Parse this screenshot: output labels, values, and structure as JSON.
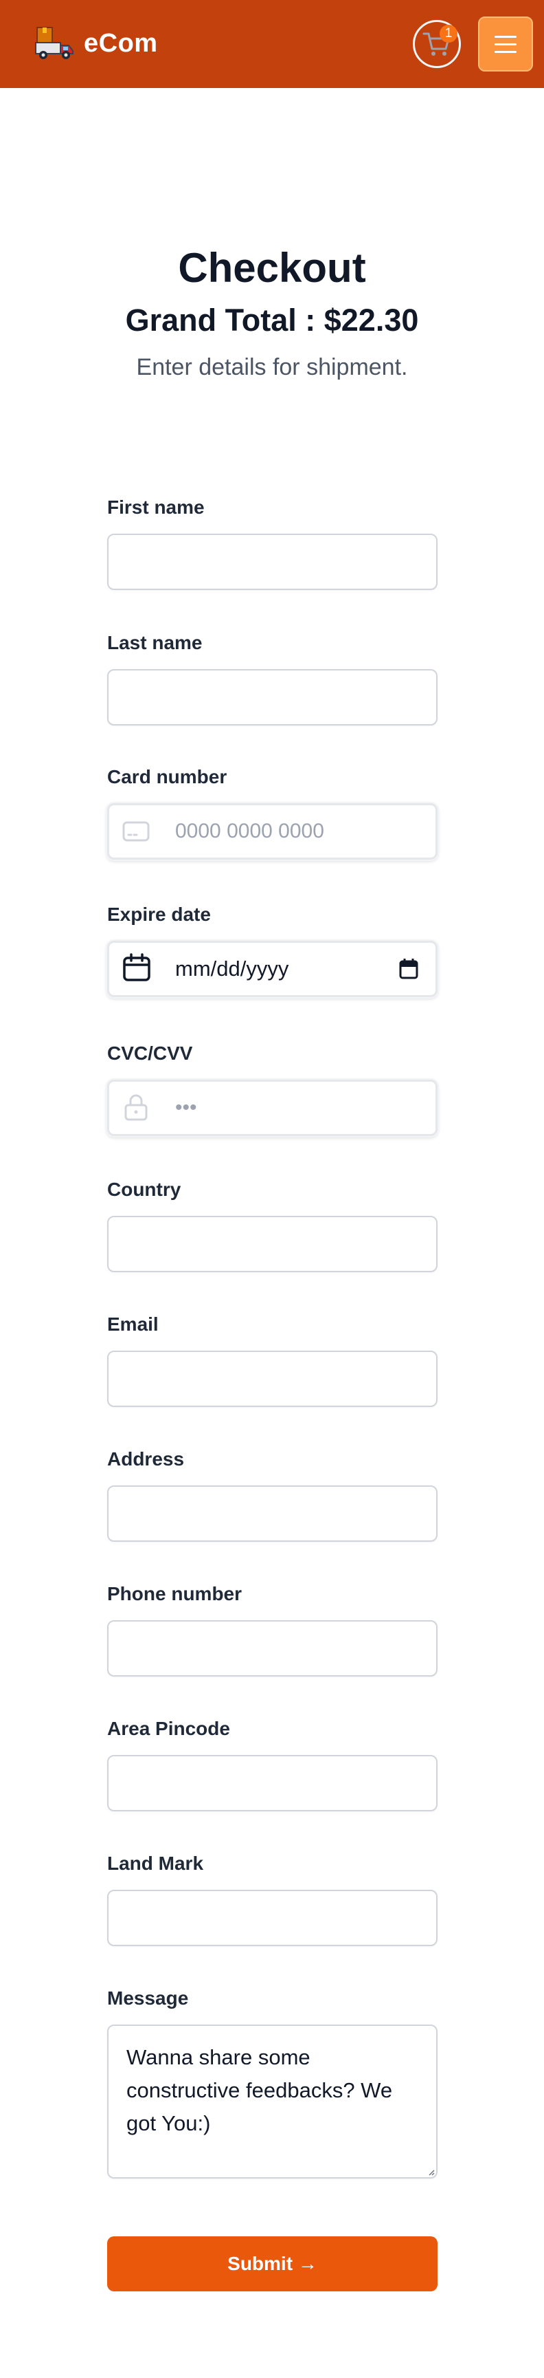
{
  "navbar": {
    "brand_name": "eCom",
    "cart_count": "1",
    "colors": {
      "bar": "#c2410c",
      "menu_button": "#fb923c",
      "badge": "#f97316"
    },
    "icons": {
      "logo": "delivery-truck-icon",
      "cart": "shopping-cart-icon",
      "menu": "hamburger-menu-icon"
    }
  },
  "checkout": {
    "title": "Checkout",
    "grand_total": "Grand Total : $22.30",
    "subtitle": "Enter details for shipment."
  },
  "form": {
    "first_name": {
      "label": "First name",
      "value": ""
    },
    "last_name": {
      "label": "Last name",
      "value": ""
    },
    "card_number": {
      "label": "Card number",
      "placeholder": "0000 0000 0000",
      "icon": "credit-card-icon"
    },
    "expire_date": {
      "label": "Expire date",
      "placeholder": "mm/dd/yyyy",
      "icon": "calendar-icon"
    },
    "cvc": {
      "label": "CVC/CVV",
      "placeholder": "•••",
      "icon": "lock-icon"
    },
    "country": {
      "label": "Country",
      "value": ""
    },
    "email": {
      "label": "Email",
      "value": ""
    },
    "address": {
      "label": "Address",
      "value": ""
    },
    "phone": {
      "label": "Phone number",
      "value": ""
    },
    "pincode": {
      "label": "Area Pincode",
      "value": ""
    },
    "landmark": {
      "label": "Land Mark",
      "value": ""
    },
    "message": {
      "label": "Message",
      "placeholder": "Wanna share some constructive feedbacks? We got You:)"
    },
    "submit_label": "Submit →",
    "submit_color": "#ea580c"
  }
}
